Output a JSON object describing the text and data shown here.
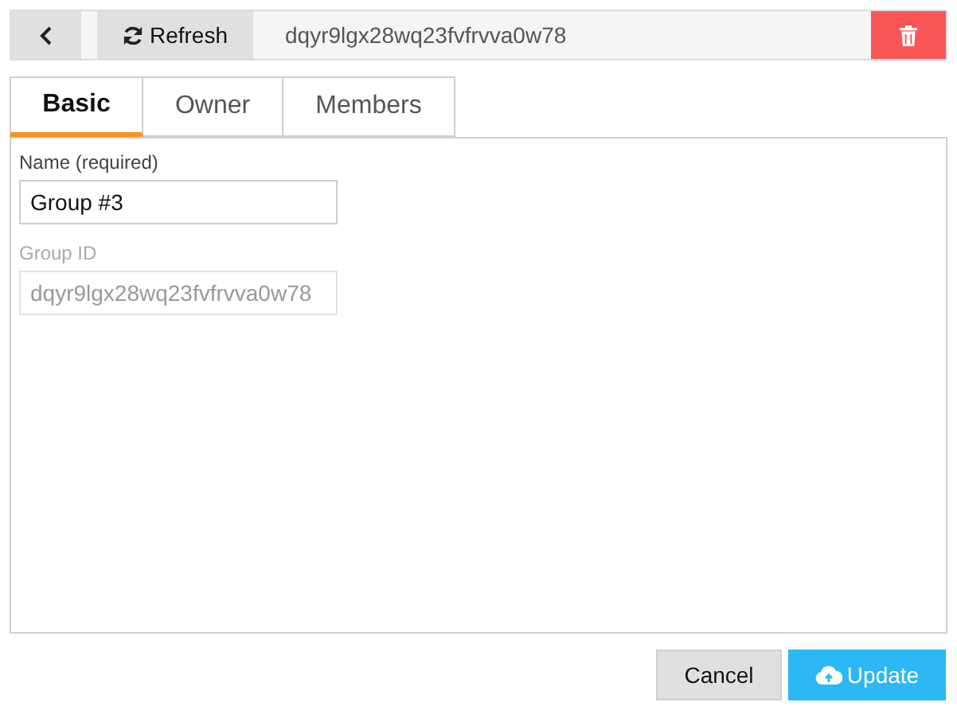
{
  "toolbar": {
    "refresh_label": "Refresh",
    "title": "dqyr9lgx28wq23fvfrvva0w78"
  },
  "tabs": [
    {
      "label": "Basic",
      "selected": true
    },
    {
      "label": "Owner",
      "selected": false
    },
    {
      "label": "Members",
      "selected": false
    }
  ],
  "fields": [
    {
      "label": "Name (required)",
      "value": "Group #3",
      "disabled": false
    },
    {
      "label": "Group ID",
      "value": "dqyr9lgx28wq23fvfrvva0w78",
      "disabled": true
    }
  ],
  "buttons": [
    {
      "kind": "cancel",
      "label": "Cancel"
    },
    {
      "kind": "update",
      "label": "Update"
    }
  ]
}
